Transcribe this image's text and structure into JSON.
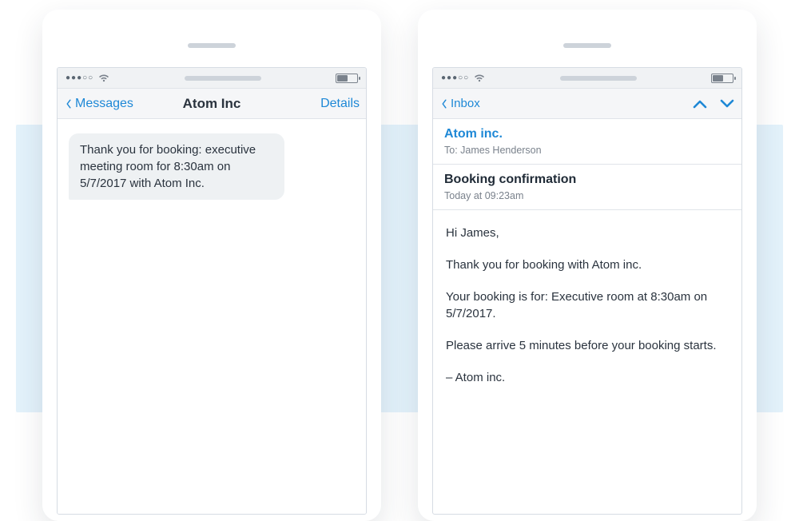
{
  "sms": {
    "nav": {
      "back": "Messages",
      "title": "Atom Inc",
      "details": "Details"
    },
    "message": "Thank you for booking: executive meeting room for 8:30am on 5/7/2017 with Atom Inc."
  },
  "email": {
    "nav": {
      "back": "Inbox"
    },
    "from": "Atom inc.",
    "to_label": "To: James Henderson",
    "subject": "Booking confirmation",
    "time": "Today at 09:23am",
    "body": {
      "greeting": "Hi James,",
      "line1": "Thank you for booking with Atom inc.",
      "line2": "Your booking is for: Executive room at 8:30am on 5/7/2017.",
      "line3": "Please arrive 5 minutes before your booking starts.",
      "signoff": "– Atom inc."
    }
  }
}
